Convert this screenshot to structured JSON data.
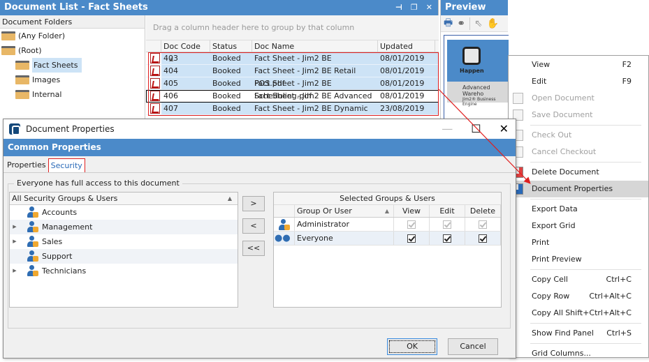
{
  "doclist": {
    "title": "Document List - Fact Sheets",
    "window_buttons": [
      "pin-icon",
      "restore-icon",
      "close-icon"
    ],
    "folders_header": "Document Folders",
    "folders": [
      {
        "label": "(Any Folder)",
        "level": 0,
        "selected": false
      },
      {
        "label": "(Root)",
        "level": 0,
        "selected": false
      },
      {
        "label": "Fact Sheets",
        "level": 1,
        "selected": true
      },
      {
        "label": "Images",
        "level": 1,
        "selected": false
      },
      {
        "label": "Internal",
        "level": 1,
        "selected": false
      }
    ],
    "group_hint": "Drag a column header here to group by that column",
    "columns": [
      "Doc Code",
      "Status",
      "Doc Name",
      "Updated"
    ],
    "sort_column": "Doc Code",
    "rows": [
      {
        "code": "403",
        "status": "Booked",
        "name": "Fact Sheet - Jim2 BE",
        "updated": "08/01/2019"
      },
      {
        "code": "404",
        "status": "Booked",
        "name": "Fact Sheet - Jim2 BE Retail POS.pdf",
        "updated": "08/01/2019"
      },
      {
        "code": "405",
        "status": "Booked",
        "name": "Fact Sheet - Jim2 BE Scheduling.pdf",
        "updated": "08/01/2019"
      },
      {
        "code": "406",
        "status": "Booked",
        "name": "Fact Sheet - Jim2 BE Advanced",
        "updated": "08/01/2019"
      },
      {
        "code": "407",
        "status": "Booked",
        "name": "Fact Sheet - Jim2 BE Dynamic",
        "updated": "23/08/2019"
      }
    ]
  },
  "preview": {
    "title": "Preview",
    "tools": [
      "print-help-icon",
      "binoculars-icon",
      "pointer-icon",
      "hand-icon"
    ],
    "logo_text": "Happen",
    "doc_caption": "Advanced Wareho",
    "doc_sub": "Jim2® Business Engine"
  },
  "context_menu": {
    "items": [
      {
        "label": "View",
        "shortcut": "F2",
        "disabled": false
      },
      {
        "label": "Edit",
        "shortcut": "F9",
        "disabled": false
      },
      {
        "label": "Open Document",
        "shortcut": "",
        "disabled": true,
        "icon": "open-document-icon"
      },
      {
        "label": "Save Document",
        "shortcut": "",
        "disabled": true,
        "icon": "save-document-icon",
        "sep_after": true
      },
      {
        "label": "Check Out",
        "shortcut": "",
        "disabled": true,
        "icon": "check-out-icon"
      },
      {
        "label": "Cancel Checkout",
        "shortcut": "",
        "disabled": true,
        "icon": "cancel-checkout-icon",
        "sep_after": true
      },
      {
        "label": "Delete Document",
        "shortcut": "",
        "disabled": false,
        "icon": "delete-document-icon"
      },
      {
        "label": "Document Properties",
        "shortcut": "",
        "disabled": false,
        "icon": "document-properties-icon",
        "highlighted": true,
        "sep_after": true
      },
      {
        "label": "Export Data",
        "shortcut": "",
        "disabled": false
      },
      {
        "label": "Export Grid",
        "shortcut": "",
        "disabled": false
      },
      {
        "label": "Print",
        "shortcut": "",
        "disabled": false
      },
      {
        "label": "Print Preview",
        "shortcut": "",
        "disabled": false,
        "sep_after": true
      },
      {
        "label": "Copy Cell",
        "shortcut": "Ctrl+C",
        "disabled": false
      },
      {
        "label": "Copy Row",
        "shortcut": "Ctrl+Alt+C",
        "disabled": false
      },
      {
        "label": "Copy All",
        "shortcut": "Shift+Ctrl+Alt+C",
        "disabled": false,
        "sep_after": true
      },
      {
        "label": "Show Find Panel",
        "shortcut": "Ctrl+S",
        "disabled": false,
        "sep_after": true
      },
      {
        "label": "Grid Columns...",
        "shortcut": "",
        "disabled": false
      }
    ]
  },
  "dialog": {
    "title": "Document Properties",
    "band": "Common Properties",
    "tabs": [
      {
        "label": "Properties",
        "active": false
      },
      {
        "label": "Security",
        "active": true
      }
    ],
    "group_label": "Everyone has full access to this document",
    "left_header": "All Security Groups & Users",
    "groups": [
      {
        "label": "Accounts",
        "expandable": false
      },
      {
        "label": "Management",
        "expandable": true
      },
      {
        "label": "Sales",
        "expandable": true
      },
      {
        "label": "Support",
        "expandable": false
      },
      {
        "label": "Technicians",
        "expandable": true
      }
    ],
    "move_buttons": [
      ">",
      "<",
      "<<"
    ],
    "right_title": "Selected Groups & Users",
    "right_columns": [
      "Group Or User",
      "View",
      "Edit",
      "Delete"
    ],
    "selected": [
      {
        "name": "Administrator",
        "view": true,
        "edit": true,
        "delete": true,
        "locked": true
      },
      {
        "name": "Everyone",
        "view": true,
        "edit": true,
        "delete": true,
        "locked": false
      }
    ],
    "ok_label": "OK",
    "cancel_label": "Cancel"
  }
}
